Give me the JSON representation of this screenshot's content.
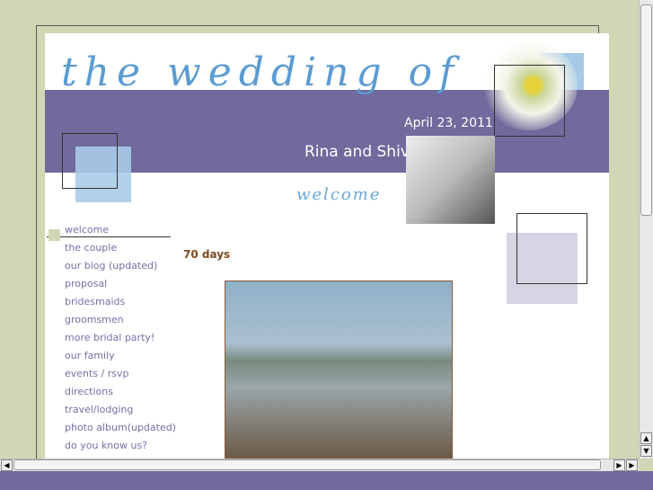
{
  "header": {
    "title_script": "the wedding of",
    "date": "April 23, 2011",
    "names": "Rina and Shiv",
    "welcome_script": "welcome"
  },
  "nav": {
    "items": [
      {
        "label": "welcome",
        "active": true
      },
      {
        "label": "the couple"
      },
      {
        "label": "our blog (updated)"
      },
      {
        "label": "proposal"
      },
      {
        "label": "bridesmaids"
      },
      {
        "label": "groomsmen"
      },
      {
        "label": "more bridal party!"
      },
      {
        "label": "our family"
      },
      {
        "label": "events / rsvp"
      },
      {
        "label": "directions"
      },
      {
        "label": "travel/lodging"
      },
      {
        "label": "photo album(updated)"
      },
      {
        "label": "do you know us?"
      }
    ]
  },
  "main": {
    "countdown": "70 days"
  },
  "colors": {
    "background": "#d3d6b4",
    "band": "#716a9c",
    "nav_text": "#7570a8",
    "countdown": "#7b4a20",
    "script": "#5b9bd2"
  }
}
